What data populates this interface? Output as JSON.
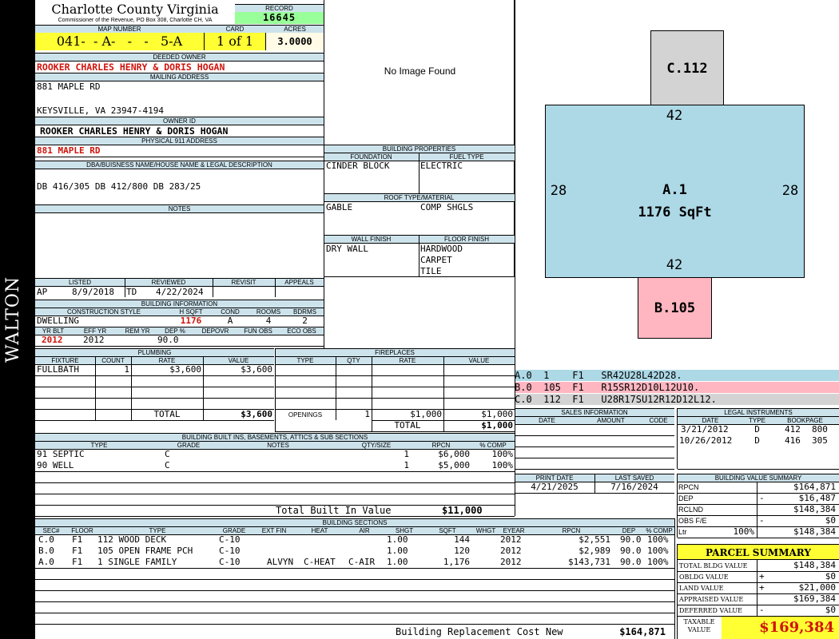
{
  "county": {
    "title": "Charlotte County Virginia",
    "subtitle": "Commissioner of the Revenue, PO Box 308, Charlotte CH, VA"
  },
  "sidebar_label": "WALTON",
  "record": {
    "label": "RECORD",
    "value": "16645"
  },
  "map": {
    "label": "MAP NUMBER",
    "value": "041-  - A-   -   -   5-A",
    "card_label": "CARD",
    "card": "1 of 1",
    "acres_label": "ACRES",
    "acres": "3.0000"
  },
  "owner": {
    "deeded_label": "DEEDED OWNER",
    "deeded": "ROOKER CHARLES HENRY & DORIS HOGAN",
    "mailing_label": "MAILING ADDRESS",
    "mailing_line1": "881 MAPLE RD",
    "mailing_line2": "KEYSVILLE, VA 23947-4194",
    "id_label": "OWNER ID",
    "id_name": "ROOKER CHARLES HENRY & DORIS HOGAN",
    "physical_label": "PHYSICAL 911 ADDRESS",
    "physical": "881 MAPLE RD"
  },
  "legal": {
    "label": "DBA/BUISNESS NAME/HOUSE NAME & LEGAL DESCRIPTION",
    "value": "DB 416/305 DB 412/800 DB 283/25"
  },
  "notes": {
    "label": "NOTES"
  },
  "image": {
    "text": "No Image Found"
  },
  "props": {
    "label": "BUILDING PROPERTIES",
    "foundation_label": "FOUNDATION",
    "fuel_label": "FUEL TYPE",
    "foundation": "CINDER BLOCK",
    "fuel": "ELECTRIC",
    "roof_label": "ROOF TYPE/MATERIAL",
    "roof_type": "GABLE",
    "roof_material": "COMP SHGLS",
    "wall_label": "WALL FINISH",
    "floor_label": "FLOOR FINISH",
    "wall": "DRY WALL",
    "floor1": "HARDWOOD",
    "floor2": "CARPET",
    "floor3": "TILE"
  },
  "sketch": {
    "c_label": "C.112",
    "a_label": "A.1",
    "a_sqft": "1176 SqFt",
    "b_label": "B.105",
    "dim_top": "42",
    "dim_bottom": "42",
    "dim_left": "28",
    "dim_right": "28",
    "colors": {
      "a": "#add8e6",
      "b": "#ffb6c1",
      "c": "#d3d3d3"
    },
    "legend": [
      {
        "text": "A.0  1    F1   SR42U28L42D28."
      },
      {
        "text": "B.0  105  F1   R15SR12D10L12U10."
      },
      {
        "text": "C.0  112  F1   U28R17SU12R12D12L12."
      }
    ]
  },
  "listed": {
    "listed_label": "LISTED",
    "reviewed_label": "REVIEWED",
    "revisit_label": "REVISIT",
    "appeals_label": "APPEALS",
    "code": "AP",
    "listed": "8/9/2018",
    "rev_code": "TD",
    "reviewed": "4/22/2024"
  },
  "building_info": {
    "label": "BUILDING INFORMATION",
    "style_label": "CONSTRUCTION STYLE",
    "hsqft_label": "H SQFT",
    "cond_label": "COND",
    "rooms_label": "ROOMS",
    "bdrms_label": "BDRMS",
    "style": "DWELLING",
    "hsqft": "1176",
    "cond": "A",
    "rooms": "4",
    "bdrms": "2",
    "yrblt_label": "YR BLT",
    "effyr_label": "EFF YR",
    "remyr_label": "REM YR",
    "dep_label": "DEP %",
    "depovr_label": "DEPOVR",
    "funobs_label": "FUN OBS",
    "ecoobs_label": "ECO OBS",
    "yrblt": "2012",
    "effyr": "2012",
    "dep": "90.0"
  },
  "plumbing": {
    "label": "PLUMBING",
    "fixture_label": "FIXTURE",
    "count_label": "COUNT",
    "rate_label": "RATE",
    "value_label": "VALUE",
    "fixture": "FULLBATH",
    "count": "1",
    "rate": "$3,600",
    "value": "$3,600",
    "total_label": "TOTAL",
    "total": "$3,600"
  },
  "fireplaces": {
    "label": "FIREPLACES",
    "type_label": "TYPE",
    "qty_label": "QTY",
    "rate_label": "RATE",
    "value_label": "VALUE",
    "openings_label": "OPENINGS",
    "openings_qty": "1",
    "openings_rate": "$1,000",
    "openings_value": "$1,000",
    "total_label": "TOTAL",
    "total": "$1,000"
  },
  "sales": {
    "label": "SALES INFORMATION",
    "date_label": "DATE",
    "amount_label": "AMOUNT",
    "code_label": "CODE"
  },
  "legal_instruments": {
    "label": "LEGAL INSTRUMENTS",
    "date_label": "DATE",
    "type_label": "TYPE",
    "bookpage_label": "BOOKPAGE",
    "rows": [
      {
        "date": "3/21/2012",
        "type": "D",
        "book": "412",
        "page": "800"
      },
      {
        "date": "10/26/2012",
        "type": "D",
        "book": "416",
        "page": "305"
      }
    ]
  },
  "builtins": {
    "label": "BUILDING BUILT INS, BASEMENTS, ATTICS & SUB SECTIONS",
    "type_label": "TYPE",
    "grade_label": "GRADE",
    "notes_label": "NOTES",
    "qty_label": "QTY/SIZE",
    "rpcn_label": "RPCN",
    "comp_label": "% COMP",
    "rows": [
      {
        "type": "91 SEPTIC",
        "grade": "C",
        "qty": "1",
        "rpcn": "$6,000",
        "comp": "100%"
      },
      {
        "type": "90 WELL",
        "grade": "C",
        "qty": "1",
        "rpcn": "$5,000",
        "comp": "100%"
      }
    ],
    "total_label": "Total Built In Value",
    "total": "$11,000"
  },
  "print": {
    "print_label": "PRINT DATE",
    "saved_label": "LAST SAVED",
    "print_date": "4/21/2025",
    "saved_date": "7/16/2024"
  },
  "value_summary": {
    "label": "BUILDING VALUE SUMMARY",
    "rows": [
      {
        "label": "RPCN",
        "sign": "",
        "value": "$164,871"
      },
      {
        "label": "DEP",
        "sign": "-",
        "value": "$16,487"
      },
      {
        "label": "RCLND",
        "sign": "",
        "value": "$148,384"
      },
      {
        "label": "OBS F/E",
        "sign": "-",
        "value": "$0"
      },
      {
        "label": "Ltr",
        "pct": "100%",
        "sign": "",
        "value": "$148,384"
      }
    ]
  },
  "sections": {
    "label": "BUILDING SECTIONS",
    "headers": {
      "sec": "SEC#",
      "floor": "FLOOR",
      "type": "TYPE",
      "grade": "GRADE",
      "extfin": "EXT FIN",
      "heat": "HEAT",
      "air": "AIR",
      "shgt": "SHGT",
      "sqft": "SQFT",
      "whgt": "WHGT",
      "eyear": "EYEAR",
      "rpcn": "RPCN",
      "dep": "DEP",
      "comp": "% COMP"
    },
    "rows": [
      {
        "sec": "C.0",
        "floor": "F1",
        "type": "112 WOOD DECK",
        "grade": "C-10",
        "extfin": "",
        "heat": "",
        "air": "",
        "shgt": "1.00",
        "sqft": "144",
        "eyear": "2012",
        "rpcn": "$2,551",
        "dep": "90.0",
        "comp": "100%"
      },
      {
        "sec": "B.0",
        "floor": "F1",
        "type": "105 OPEN FRAME PCH",
        "grade": "C-10",
        "extfin": "",
        "heat": "",
        "air": "",
        "shgt": "1.00",
        "sqft": "120",
        "eyear": "2012",
        "rpcn": "$2,989",
        "dep": "90.0",
        "comp": "100%"
      },
      {
        "sec": "A.0",
        "floor": "F1",
        "type": "1 SINGLE FAMILY",
        "grade": "C-10",
        "extfin": "ALVYN",
        "heat": "C-HEAT",
        "air": "C-AIR",
        "shgt": "1.00",
        "sqft": "1,176",
        "eyear": "2012",
        "rpcn": "$143,731",
        "dep": "90.0",
        "comp": "100%"
      }
    ],
    "replacement_label": "Building Replacement Cost New",
    "replacement": "$164,871"
  },
  "parcel": {
    "label": "PARCEL SUMMARY",
    "rows": [
      {
        "label": "TOTAL BLDG VALUE",
        "sign": "",
        "value": "$148,384"
      },
      {
        "label": "OBLDG VALUE",
        "sign": "+",
        "value": "$0"
      },
      {
        "label": "LAND VALUE",
        "sign": "+",
        "value": "$21,000"
      },
      {
        "label": "APPRAISED VALUE",
        "sign": "",
        "value": "$169,384"
      },
      {
        "label": "DEFERRED VALUE",
        "sign": "-",
        "value": "$0"
      }
    ],
    "taxable_label1": "TAXABLE",
    "taxable_label2": "VALUE",
    "taxable": "$169,384"
  }
}
